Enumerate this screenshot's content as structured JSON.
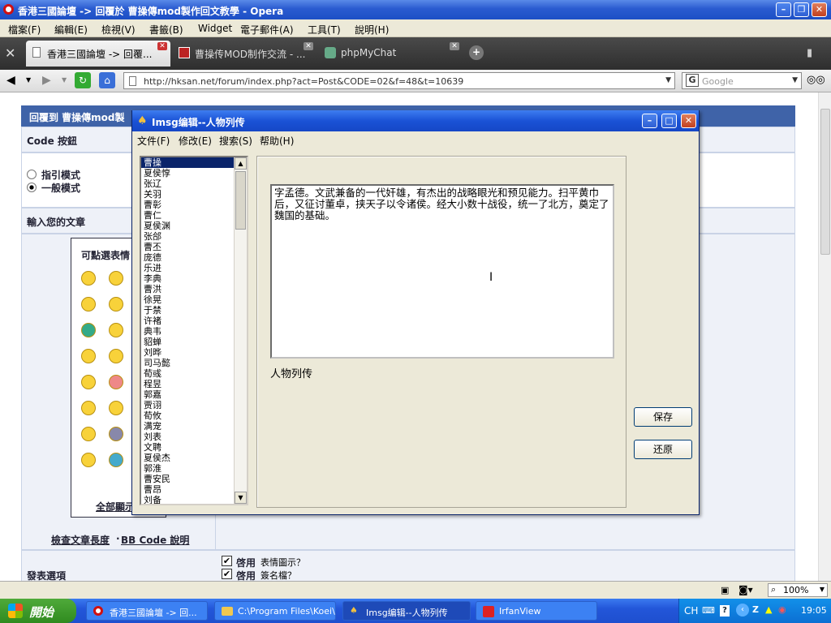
{
  "opera": {
    "title": "香港三國論壇 -> 回覆於 曹操傳mod製作回文教學 - Opera",
    "menu": [
      "檔案(F)",
      "編輯(E)",
      "檢視(V)",
      "書籤(B)",
      "Widget",
      "電子郵件(A)",
      "工具(T)",
      "說明(H)"
    ],
    "tabs": [
      "香港三國論壇 -> 回覆...",
      "曹操传MOD制作交流 - ...",
      "phpMyChat"
    ],
    "url": "http://hksan.net/forum/index.php?act=Post&CODE=02&f=48&t=10639",
    "search_placeholder": "Google",
    "zoom": "100%"
  },
  "forum": {
    "reply_header": "回覆到 曹操傳mod製",
    "code_buttons": "Code 按鈕",
    "mode_guided": "指引模式",
    "mode_normal": "一般模式",
    "input_article": "輸入您的文章",
    "emoticons_title": "可點選表情",
    "show_all": "全部顯示",
    "check_length": "檢查文章長度",
    "bbcode_help": "BB Code 說明",
    "post_options": "發表選項",
    "opt_emoticons_strong": "啓用",
    "opt_emoticons": "表情圖示？",
    "opt_signature_strong": "啓用",
    "opt_signature": "簽名檔？"
  },
  "dialog": {
    "title": "Imsg编辑--人物列传",
    "menu": [
      "文件(F)",
      "修改(E)",
      "搜索(S)",
      "帮助(H)"
    ],
    "characters": [
      "曹操",
      "夏侯惇",
      "张辽",
      "关羽",
      "曹彰",
      "曹仁",
      "夏侯渊",
      "张郃",
      "曹丕",
      "庞德",
      "乐进",
      "李典",
      "曹洪",
      "徐晃",
      "于禁",
      "许褚",
      "典韦",
      "貂蝉",
      "刘晔",
      "司马懿",
      "荀彧",
      "程昱",
      "郭嘉",
      "贾诩",
      "荀攸",
      "满宠",
      "刘表",
      "文聘",
      "夏侯杰",
      "郭淮",
      "曹安民",
      "曹昂",
      "刘备"
    ],
    "selected_index": 0,
    "bio_text": "字孟德。文武兼备的一代奸雄，有杰出的战略眼光和预见能力。扫平黄巾后，又征讨董卓，挟天子以令诸侯。经大小数十战役，统一了北方，奠定了魏国的基础。",
    "section_label": "人物列传",
    "save_label": "保存",
    "restore_label": "还原"
  },
  "taskbar": {
    "start_label": "開始",
    "tasks": [
      "香港三國論壇 -> 回...",
      "C:\\Program Files\\Koei\\...",
      "Imsg编辑--人物列传",
      "IrfanView"
    ],
    "active_task": 2,
    "ime": "CH",
    "time": "19:05"
  }
}
